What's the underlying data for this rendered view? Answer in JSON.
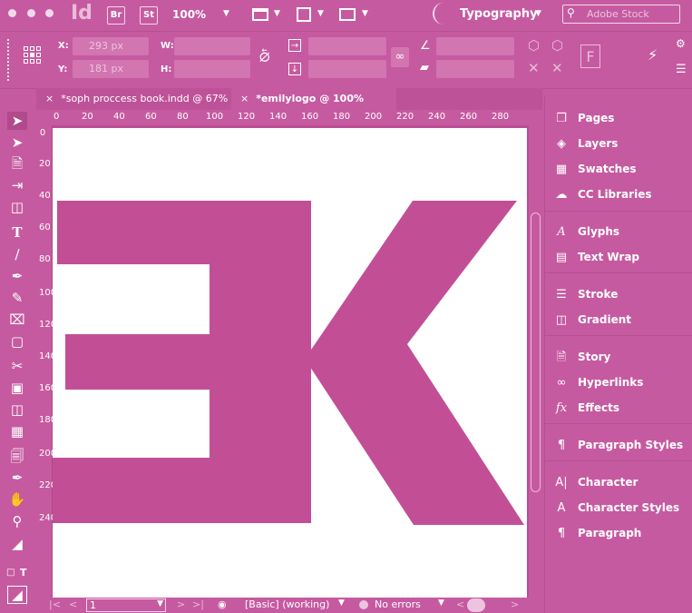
{
  "appbar": {
    "logo": "Id",
    "bridge_badge": "Br",
    "stock_badge": "St",
    "zoom": "100%",
    "workspace": "Typography",
    "search_placeholder": "Adobe Stock"
  },
  "control": {
    "x_label": "X:",
    "x_value": "293 px",
    "y_label": "Y:",
    "y_value": "181 px",
    "w_label": "W:",
    "h_label": "H:"
  },
  "tabs": [
    {
      "label": "*soph proccess book.indd @ 67%"
    },
    {
      "label": "*emilylogo @ 100%"
    }
  ],
  "ruler": {
    "h_ticks": [
      "0",
      "20",
      "40",
      "60",
      "80",
      "100",
      "120",
      "140",
      "160",
      "180",
      "200",
      "220",
      "240",
      "260",
      "280"
    ],
    "v_ticks": [
      "0",
      "20",
      "40",
      "60",
      "80",
      "100",
      "120",
      "140",
      "160",
      "180",
      "200",
      "220",
      "240"
    ]
  },
  "status": {
    "page": "1",
    "style": "[Basic] (working)",
    "preflight": "No errors"
  },
  "panels": [
    {
      "label": "Pages",
      "icon": "pages-icon"
    },
    {
      "label": "Layers",
      "icon": "layers-icon"
    },
    {
      "label": "Swatches",
      "icon": "swatches-icon"
    },
    {
      "label": "CC Libraries",
      "icon": "cc-libraries-icon"
    },
    {
      "label": "Glyphs",
      "icon": "glyphs-icon"
    },
    {
      "label": "Text Wrap",
      "icon": "text-wrap-icon"
    },
    {
      "label": "Stroke",
      "icon": "stroke-icon"
    },
    {
      "label": "Gradient",
      "icon": "gradient-icon"
    },
    {
      "label": "Story",
      "icon": "story-icon"
    },
    {
      "label": "Hyperlinks",
      "icon": "hyperlinks-icon"
    },
    {
      "label": "Effects",
      "icon": "effects-icon"
    },
    {
      "label": "Paragraph Styles",
      "icon": "paragraph-styles-icon"
    },
    {
      "label": "Character",
      "icon": "character-icon"
    },
    {
      "label": "Character Styles",
      "icon": "character-styles-icon"
    },
    {
      "label": "Paragraph",
      "icon": "paragraph-icon"
    }
  ],
  "colors": {
    "ui_tint": "#c65aa0",
    "artwork": "#c24f96",
    "page": "#ffffff"
  }
}
